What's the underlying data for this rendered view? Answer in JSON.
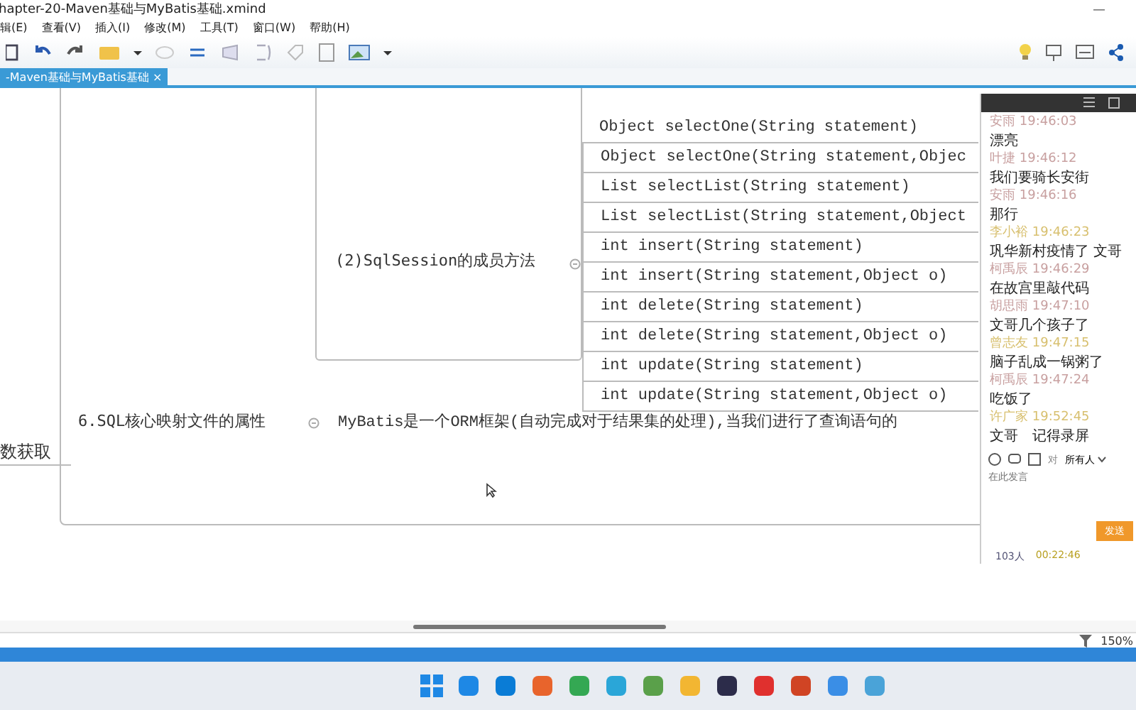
{
  "window": {
    "title": "hapter-20-Maven基础与MyBatis基础.xmind",
    "minimize": "—"
  },
  "menu": [
    {
      "label": "辑(E)"
    },
    {
      "label": "查看(V)"
    },
    {
      "label": "插入(I)"
    },
    {
      "label": "修改(M)"
    },
    {
      "label": "工具(T)"
    },
    {
      "label": "窗口(W)"
    },
    {
      "label": "帮助(H)"
    }
  ],
  "tabs": [
    {
      "label": "-Maven基础与MyBatis基础",
      "selected": true,
      "close": "×"
    }
  ],
  "mindmap": {
    "topic": "(2)SqlSession的成员方法",
    "methods": [
      "Object selectOne(String statement)",
      "Object selectOne(String statement,Objec",
      "List selectList(String statement)",
      "List selectList(String statement,Object",
      "int insert(String statement)",
      "int insert(String statement,Object o)",
      "int delete(String statement)",
      "int delete(String statement,Object o)",
      "int update(String statement)",
      "int update(String statement,Object o)"
    ],
    "branch": "6.SQL核心映射文件的属性",
    "note": "MyBatis是一个ORM框架(自动完成对于结果集的处理),当我们进行了查询语句的",
    "left_fragment": "数获取"
  },
  "chat": {
    "messages": [
      {
        "header": "安雨 19:46:03",
        "text": "漂亮",
        "color": "#c8a0a0"
      },
      {
        "header": "叶捷 19:46:12",
        "text": "我们要骑长安街",
        "color": "#c8a0a0"
      },
      {
        "header": "安雨 19:46:16",
        "text": "那行",
        "color": "#c8a0a0"
      },
      {
        "header": "李小裕 19:46:23",
        "text": "巩华新村疫情了 文哥",
        "color": "#d8c070"
      },
      {
        "header": "柯禹辰 19:46:29",
        "text": "在故宫里敲代码",
        "color": "#c8a0a0"
      },
      {
        "header": "胡思雨 19:47:10",
        "text": "文哥几个孩子了",
        "color": "#c8a0a0"
      },
      {
        "header": "曾志友 19:47:15",
        "text": "脑子乱成一锅粥了",
        "color": "#d8c070"
      },
      {
        "header": "柯禹辰 19:47:24",
        "text": "吃饭了",
        "color": "#c8a0a0"
      },
      {
        "header": "许广家 19:52:45",
        "text": "文哥　记得录屏",
        "color": "#d8c070"
      }
    ],
    "to_label": "对",
    "recipient": "所有人",
    "placeholder": "在此发言",
    "send": "发送",
    "count": "103人",
    "elapsed": "00:22:46"
  },
  "status_bar": {
    "zoom": "150%"
  }
}
